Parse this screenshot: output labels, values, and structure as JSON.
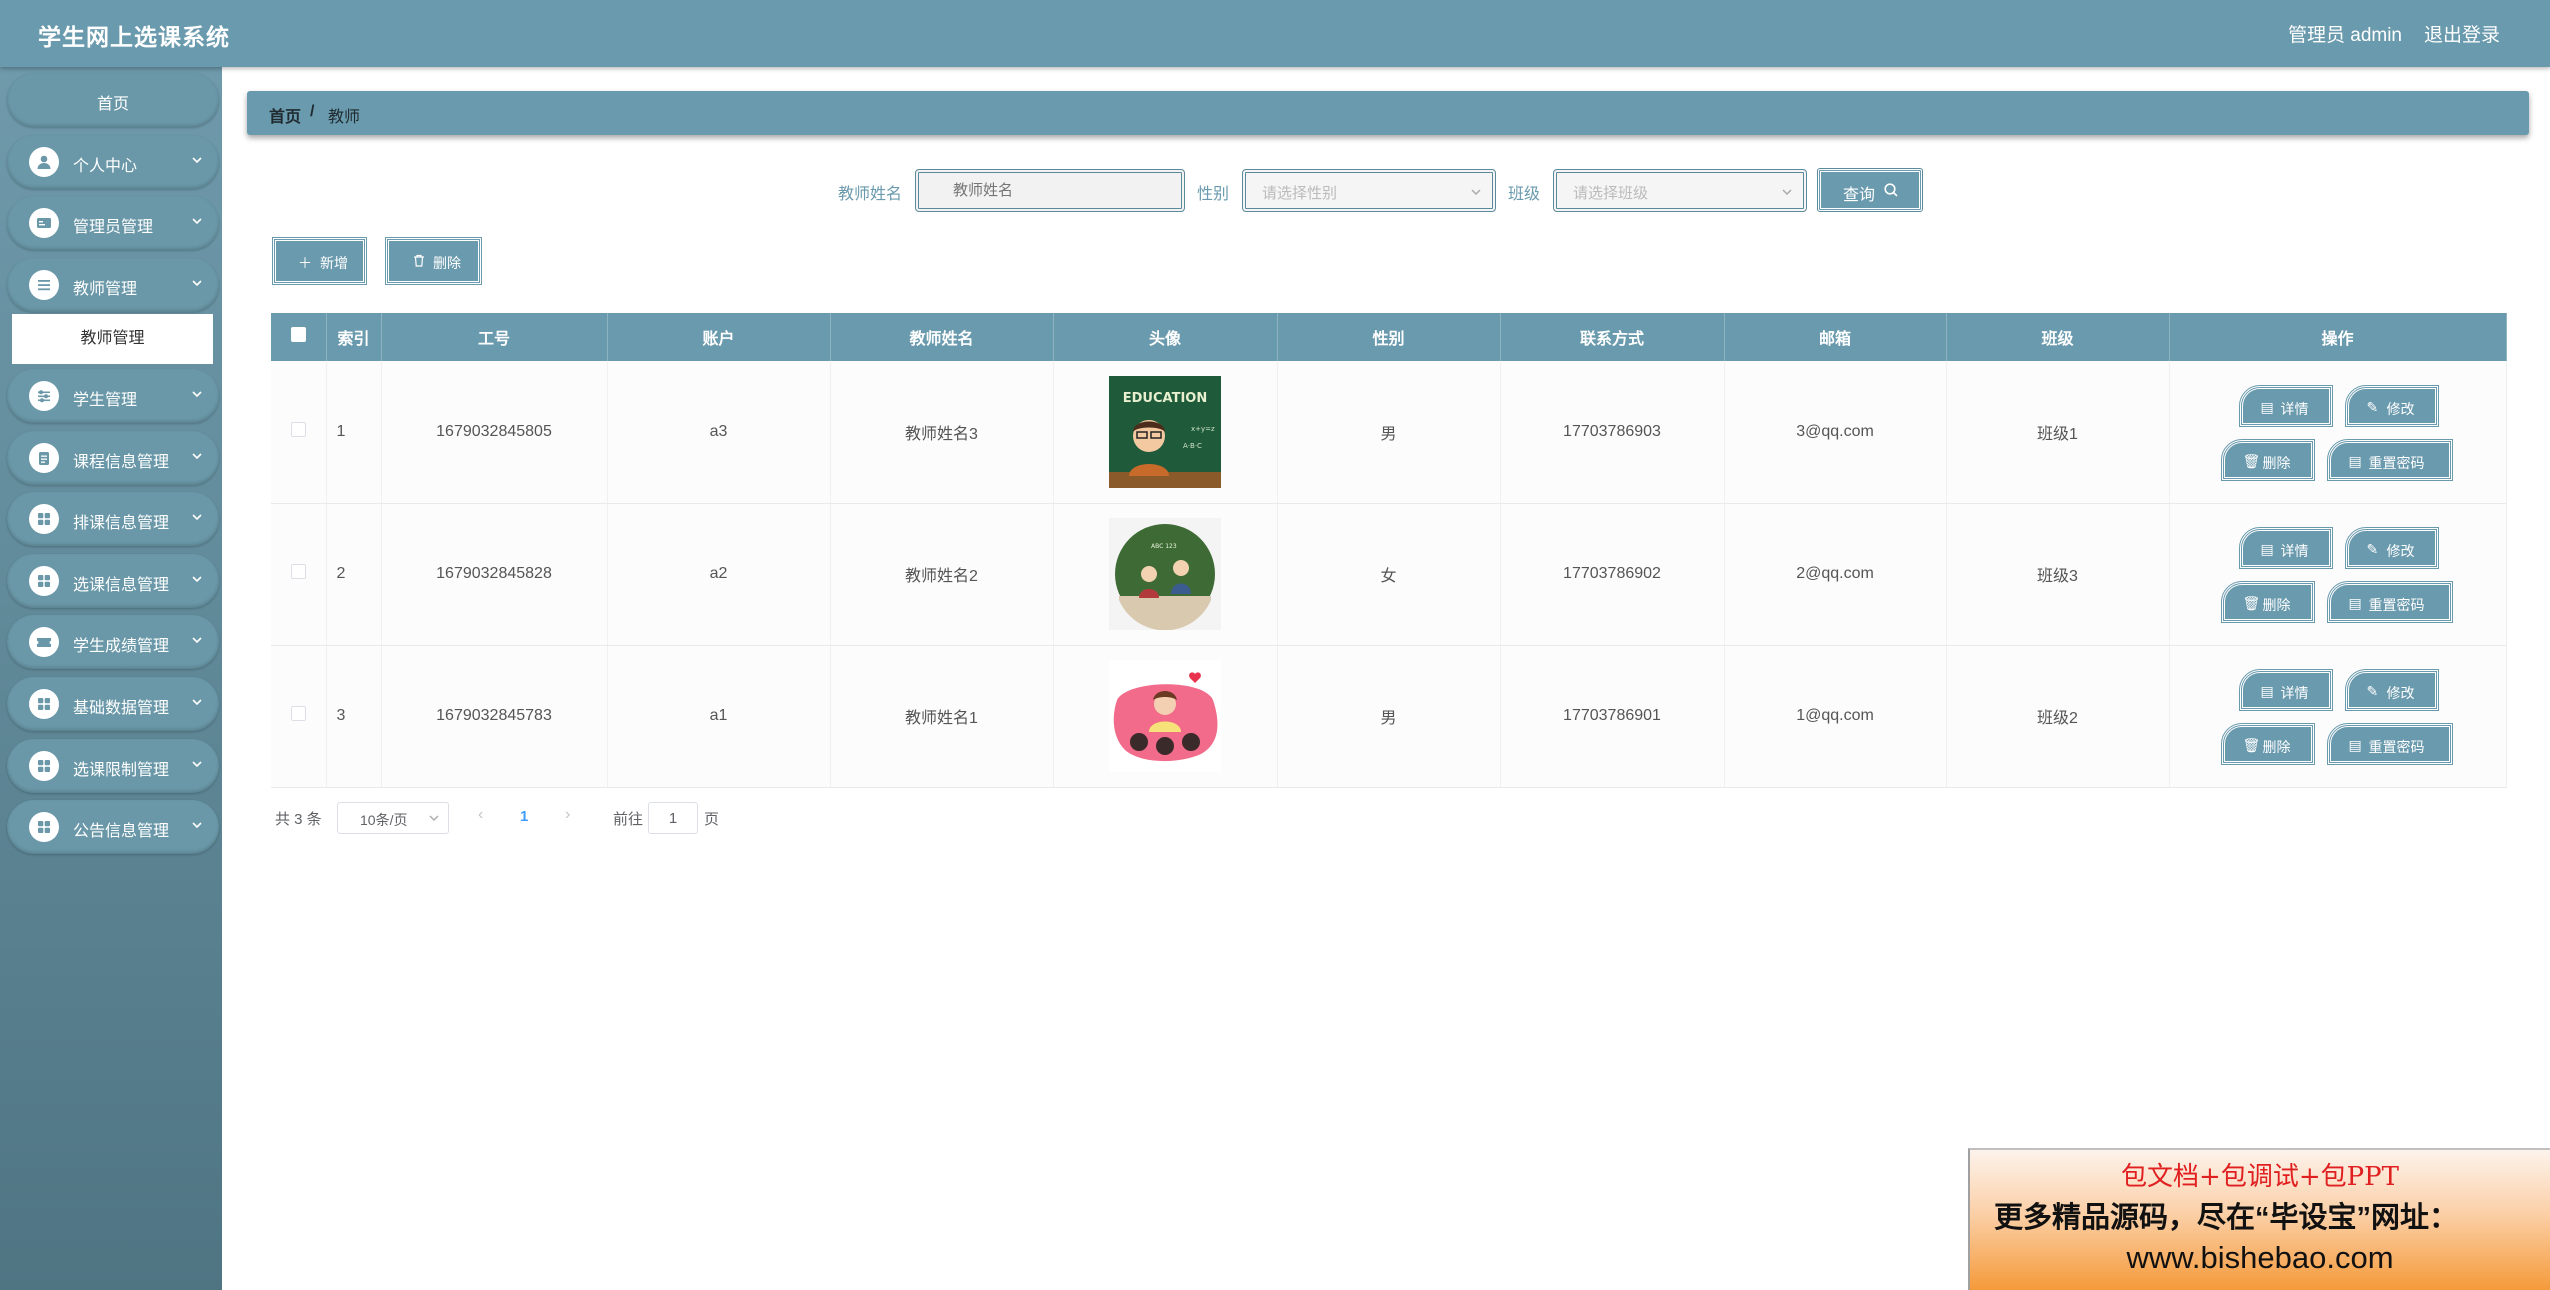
{
  "header": {
    "title": "学生网上选课系统",
    "admin_label": "管理员 admin",
    "logout_label": "退出登录"
  },
  "sidebar": {
    "items": [
      {
        "label": "首页",
        "icon": "home"
      },
      {
        "label": "个人中心",
        "icon": "user-icon"
      },
      {
        "label": "管理员管理",
        "icon": "id-card-icon"
      },
      {
        "label": "教师管理",
        "icon": "list-icon"
      },
      {
        "label": "学生管理",
        "icon": "sliders-icon"
      },
      {
        "label": "课程信息管理",
        "icon": "clipboard-icon"
      },
      {
        "label": "排课信息管理",
        "icon": "grid-icon"
      },
      {
        "label": "选课信息管理",
        "icon": "grid-icon"
      },
      {
        "label": "学生成绩管理",
        "icon": "ticket-icon"
      },
      {
        "label": "基础数据管理",
        "icon": "grid-icon"
      },
      {
        "label": "选课限制管理",
        "icon": "grid-icon"
      },
      {
        "label": "公告信息管理",
        "icon": "grid-icon"
      }
    ],
    "active_sub": "教师管理"
  },
  "breadcrumb": {
    "home": "首页",
    "separator": "/",
    "current": "教师"
  },
  "search": {
    "name_label": "教师姓名",
    "name_placeholder": "教师姓名",
    "gender_label": "性别",
    "gender_placeholder": "请选择性别",
    "class_label": "班级",
    "class_placeholder": "请选择班级",
    "query_label": "查询"
  },
  "actions": {
    "add_label": "新增",
    "delete_label": "删除"
  },
  "table": {
    "columns": [
      "索引",
      "工号",
      "账户",
      "教师姓名",
      "头像",
      "性别",
      "联系方式",
      "邮箱",
      "班级",
      "操作"
    ],
    "rows": [
      {
        "index": "1",
        "job_no": "1679032845805",
        "account": "a3",
        "name": "教师姓名3",
        "gender": "男",
        "phone": "17703786903",
        "email": "3@qq.com",
        "class": "班级1",
        "avatar_text": "EDUCATION"
      },
      {
        "index": "2",
        "job_no": "1679032845828",
        "account": "a2",
        "name": "教师姓名2",
        "gender": "女",
        "phone": "17703786902",
        "email": "2@qq.com",
        "class": "班级3"
      },
      {
        "index": "3",
        "job_no": "1679032845783",
        "account": "a1",
        "name": "教师姓名1",
        "gender": "男",
        "phone": "17703786901",
        "email": "1@qq.com",
        "class": "班级2"
      }
    ],
    "op_labels": {
      "detail": "详情",
      "edit": "修改",
      "delete": "删除",
      "reset": "重置密码"
    }
  },
  "pagination": {
    "total": "共 3 条",
    "page_size": "10条/页",
    "current": "1",
    "goto_label": "前往",
    "goto_value": "1",
    "unit": "页"
  },
  "banner": {
    "line1": "包文档+包调试+包PPT",
    "line2": "更多精品源码，尽在“毕设宝”网址：",
    "line3": "www.bishebao.com"
  },
  "colors": {
    "primary": "#6a9aad",
    "link": "#409eff"
  }
}
